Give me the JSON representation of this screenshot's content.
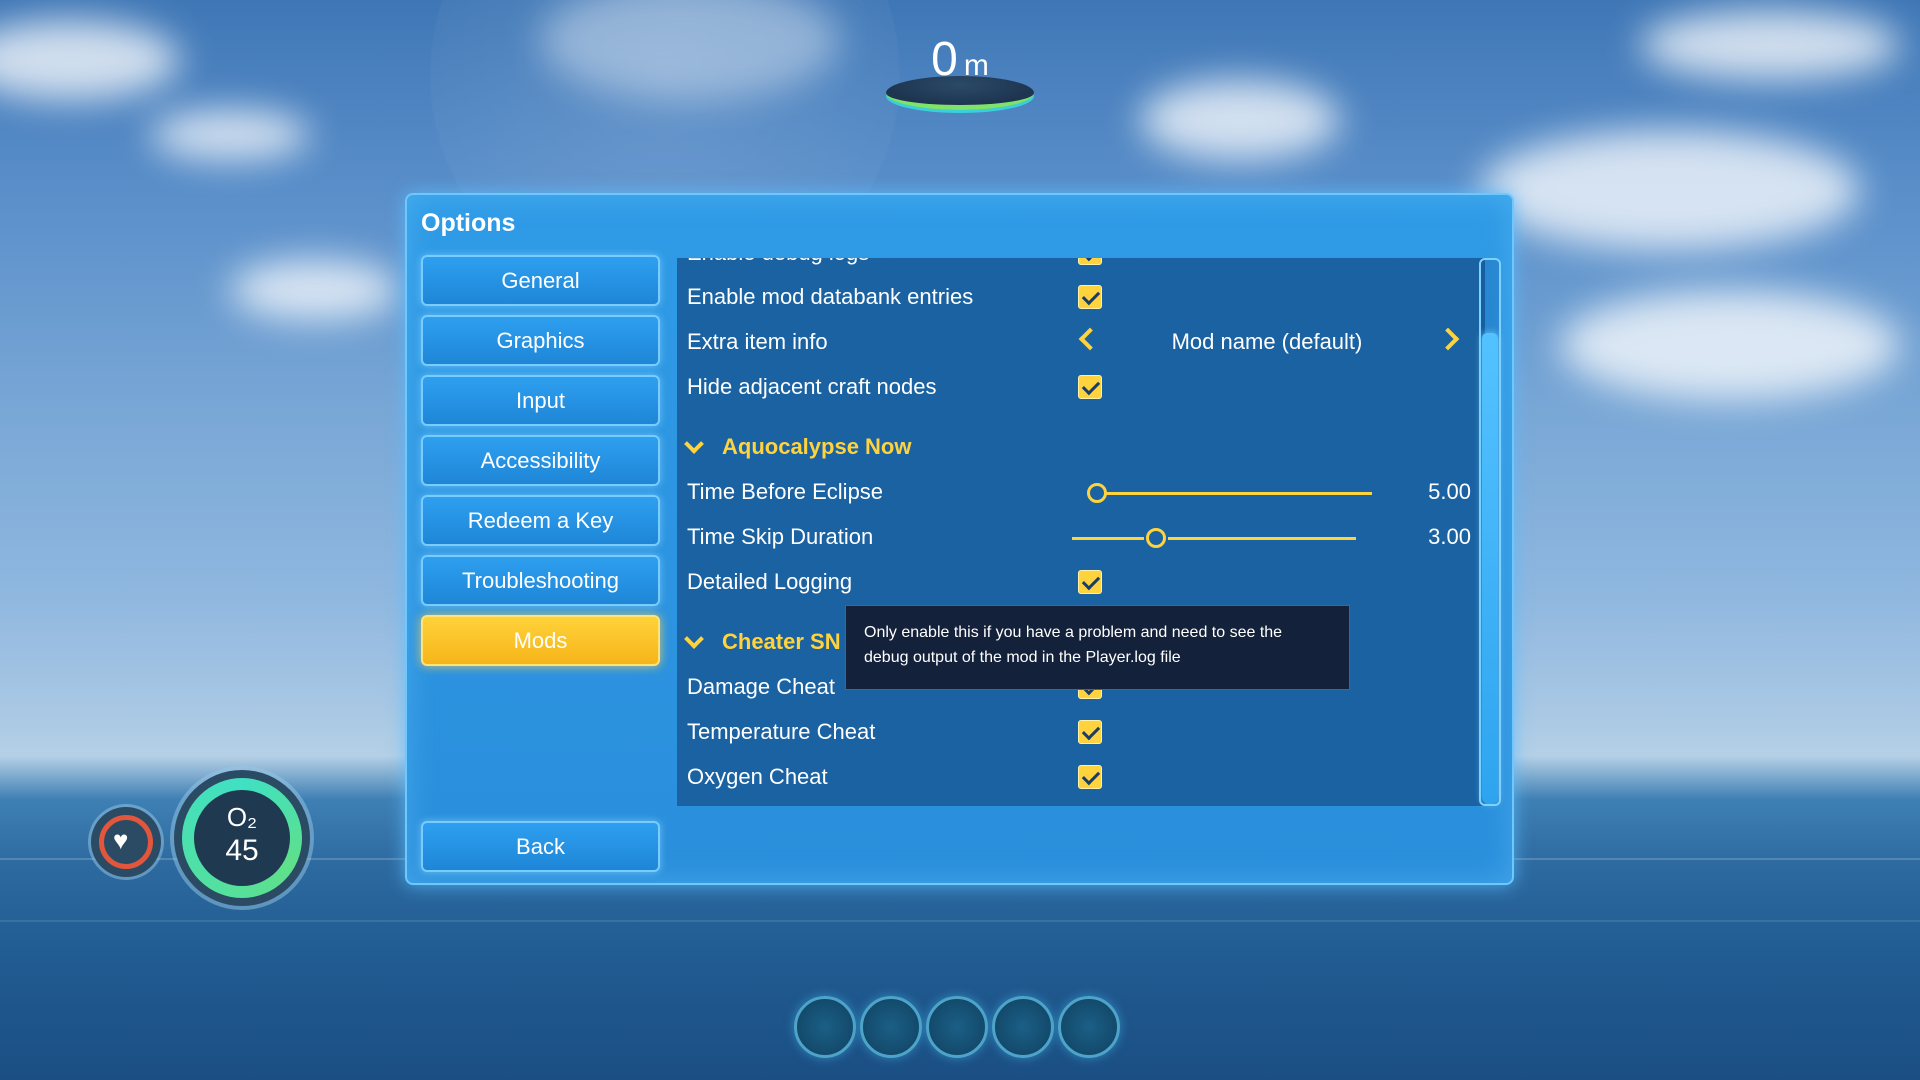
{
  "hud": {
    "depth_value": "0",
    "depth_unit": "m",
    "oxygen_label": "O₂",
    "oxygen_value": "45",
    "quickslots": 5
  },
  "options": {
    "title": "Options",
    "nav": [
      {
        "label": "General"
      },
      {
        "label": "Graphics"
      },
      {
        "label": "Input"
      },
      {
        "label": "Accessibility"
      },
      {
        "label": "Redeem a Key"
      },
      {
        "label": "Troubleshooting"
      },
      {
        "label": "Mods"
      }
    ],
    "active_nav": "Mods",
    "back_label": "Back"
  },
  "mods": {
    "partial_row": {
      "label": "Enable debug logs",
      "checked": true
    },
    "rows_top": [
      {
        "label": "Enable mod databank entries",
        "checked": true
      },
      {
        "label": "Extra item info",
        "choice": "Mod name (default)"
      },
      {
        "label": "Hide adjacent craft nodes",
        "checked": true
      }
    ],
    "section_aquocalypse": {
      "title": "Aquocalypse Now",
      "time_before_eclipse": {
        "label": "Time Before Eclipse",
        "value": "5.00",
        "fraction": 0.0
      },
      "time_skip_duration": {
        "label": "Time Skip Duration",
        "value": "3.00",
        "fraction": 0.3
      },
      "detailed_logging": {
        "label": "Detailed Logging",
        "checked": true
      }
    },
    "section_cheater": {
      "title": "Cheater SN",
      "damage_cheat": {
        "label": "Damage Cheat",
        "checked": true
      },
      "temperature_cheat": {
        "label": "Temperature Cheat",
        "checked": true
      },
      "oxygen_cheat": {
        "label": "Oxygen Cheat",
        "checked": true
      }
    }
  },
  "tooltip": {
    "text_line1": "Only enable this if you have a problem and need to see the",
    "text_line2": "debug output of the mod in the Player.log file"
  },
  "colors": {
    "accent": "#ffd33d",
    "panel": "#2a8fdc",
    "content": "#1a62a2"
  }
}
